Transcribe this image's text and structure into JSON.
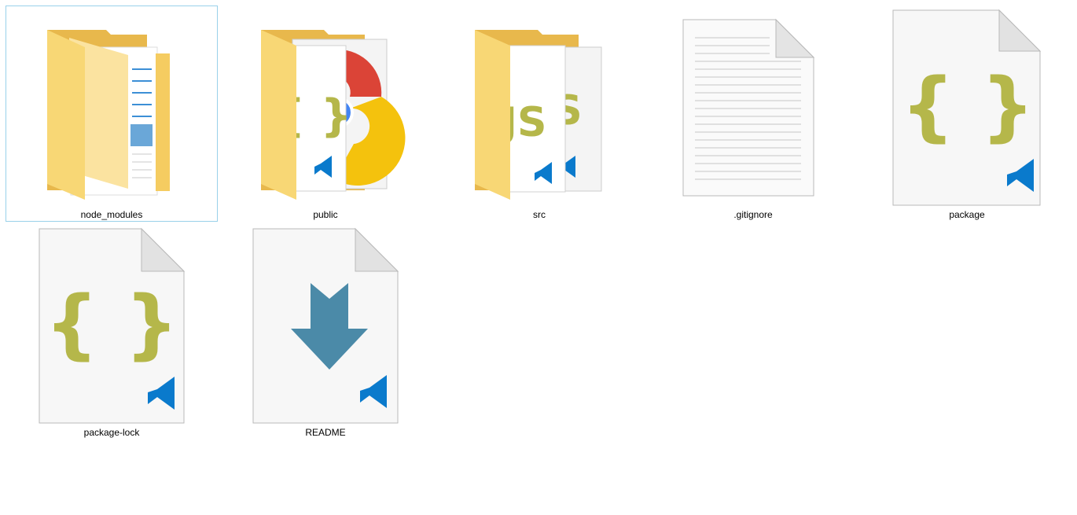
{
  "window": {
    "view_mode": "Extra large icons"
  },
  "items": [
    {
      "name": "node_modules",
      "kind": "folder",
      "icon": "folder-icon",
      "selected": true
    },
    {
      "name": "public",
      "kind": "folder",
      "icon": "folder-icon",
      "selected": false
    },
    {
      "name": "src",
      "kind": "folder",
      "icon": "folder-icon",
      "selected": false
    },
    {
      "name": ".gitignore",
      "kind": "file",
      "icon": "text-file-icon",
      "selected": false
    },
    {
      "name": "package",
      "kind": "file",
      "icon": "json-file-icon",
      "selected": false
    },
    {
      "name": "package-lock",
      "kind": "file",
      "icon": "json-file-icon",
      "selected": false
    },
    {
      "name": "README",
      "kind": "file",
      "icon": "markdown-file-icon",
      "selected": false
    }
  ],
  "colors": {
    "selection_border": "#99d1ea",
    "folder_yellow": "#f8d775",
    "json_brace": "#b5b74a",
    "vscode_blue": "#0a7acc",
    "markdown_arrow": "#4b8aa8"
  }
}
